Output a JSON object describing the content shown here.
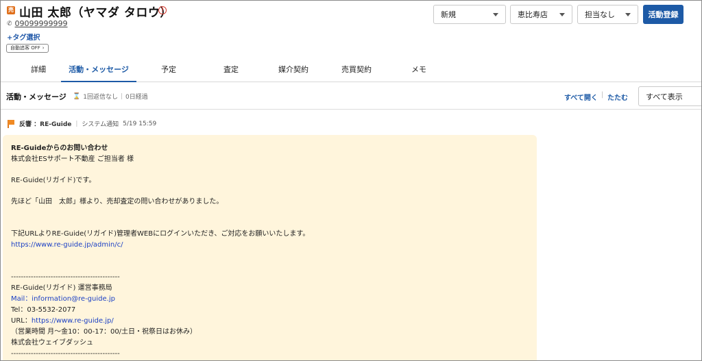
{
  "header": {
    "badge": "売",
    "name": "山田 太郎（ヤマダ タロウ）",
    "alert_icon": "alert-circle-icon",
    "phone": "09099999999",
    "tag_select": "+タグ選択",
    "auto_chase": "自動追客 OFF",
    "status_select": "新規",
    "store_select": "恵比寿店",
    "owner_select": "担当なし",
    "register_button": "活動登録",
    "accent_color": "#1d5aa6",
    "badge_color": "#e0701c"
  },
  "tabs": [
    {
      "label": "詳細"
    },
    {
      "label": "活動・メッセージ",
      "active": true
    },
    {
      "label": "予定"
    },
    {
      "label": "査定"
    },
    {
      "label": "媒介契約"
    },
    {
      "label": "売買契約"
    },
    {
      "label": "メモ"
    }
  ],
  "section": {
    "title": "活動・メッセージ",
    "reply_status": "1回返信なし",
    "elapsed": "0日経過",
    "expand_all": "すべて開く",
    "collapse": "たたむ",
    "view_select": "すべて表示"
  },
  "activity": {
    "type": "反響 ：RE-Guide",
    "source": "システム通知",
    "datetime": "5/19 15:59",
    "message": {
      "subject": "RE-Guideからのお問い合わせ",
      "to": "株式会社ESサポート不動産 ご担当者 様",
      "intro": "RE-Guide(リガイド)です。",
      "body1": "先ほど「山田　太郎」様より、売却査定の問い合わせがありました。",
      "body2": "下記URLよりRE-Guide(リガイド)管理者WEBにログインいただき、ご対応をお願いいたします。",
      "admin_url": "https://www.re-guide.jp/admin/c/",
      "divider": "--------------------------------------------",
      "office": "RE-Guide(リガイド) 運営事務局",
      "mail_label": "Mail：information@re-guide.jp",
      "tel": "Tel：03-5532-2077",
      "url_label": "URL：",
      "url": "https://www.re-guide.jp/",
      "hours": "（営業時間 月～金10：00-17：00/土日・祝祭日はお休み）",
      "company": "株式会社ウェイブダッシュ",
      "divider2": "--------------------------------------------"
    }
  }
}
